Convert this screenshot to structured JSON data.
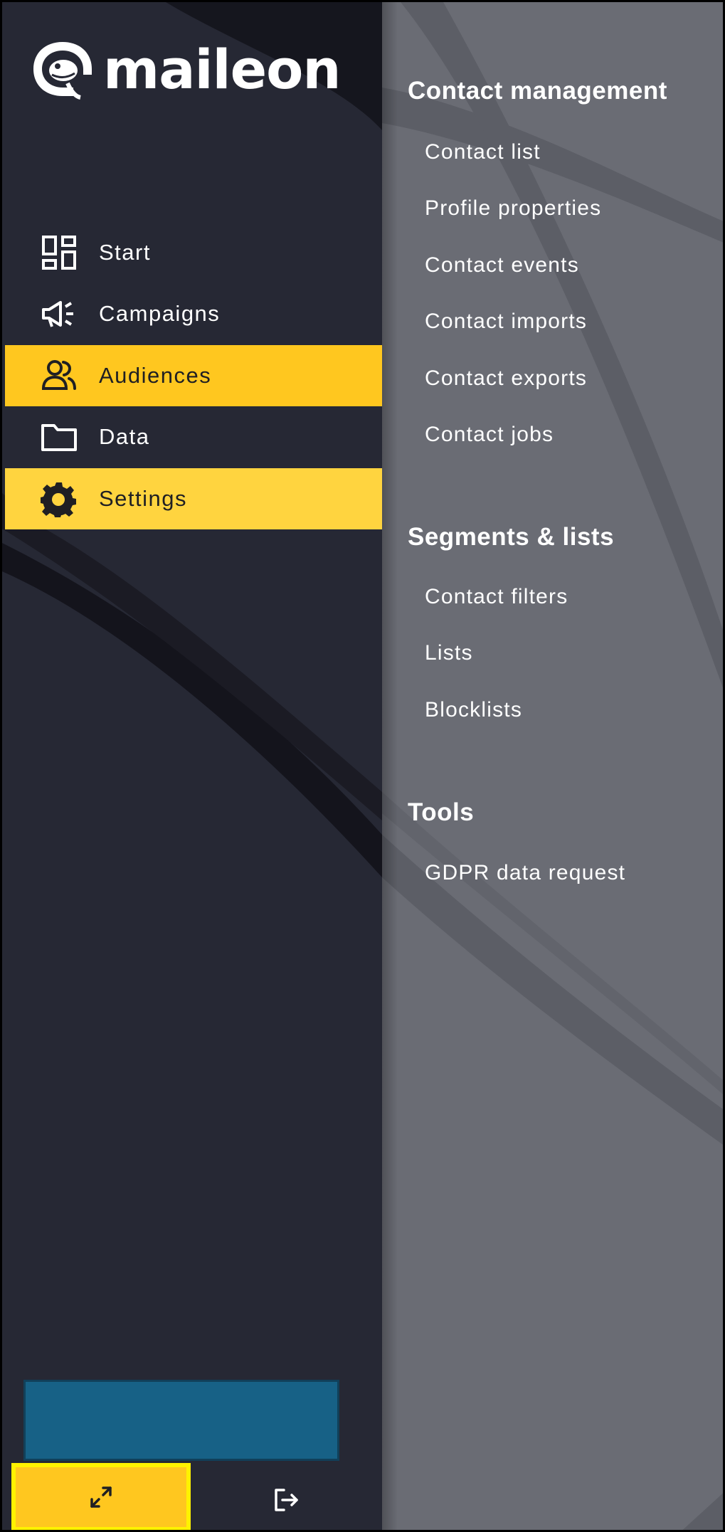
{
  "logo": {
    "wordmark": "maileon"
  },
  "sidebar": {
    "items": [
      {
        "label": "Start",
        "icon": "dashboard-icon",
        "state": "normal"
      },
      {
        "label": "Campaigns",
        "icon": "megaphone-icon",
        "state": "normal"
      },
      {
        "label": "Audiences",
        "icon": "people-icon",
        "state": "active"
      },
      {
        "label": "Data",
        "icon": "folder-icon",
        "state": "normal"
      },
      {
        "label": "Settings",
        "icon": "gear-icon",
        "state": "hovered"
      }
    ]
  },
  "submenu": {
    "sections": [
      {
        "title": "Contact management",
        "links": [
          "Contact list",
          "Profile properties",
          "Contact events",
          "Contact imports",
          "Contact exports",
          "Contact jobs"
        ]
      },
      {
        "title": "Segments & lists",
        "links": [
          "Contact filters",
          "Lists",
          "Blocklists"
        ]
      },
      {
        "title": "Tools",
        "links": [
          "GDPR data request"
        ]
      }
    ]
  },
  "footer": {
    "collapse_icon": "collapse-arrows-icon",
    "logout_icon": "logout-icon"
  },
  "colors": {
    "sidebar_bg": "#262834",
    "panel_bg": "#6a6c74",
    "accent": "#ffc71f",
    "accent_hover": "#ffd43f",
    "highlight_border": "#fff200",
    "blue_box": "#176186"
  }
}
